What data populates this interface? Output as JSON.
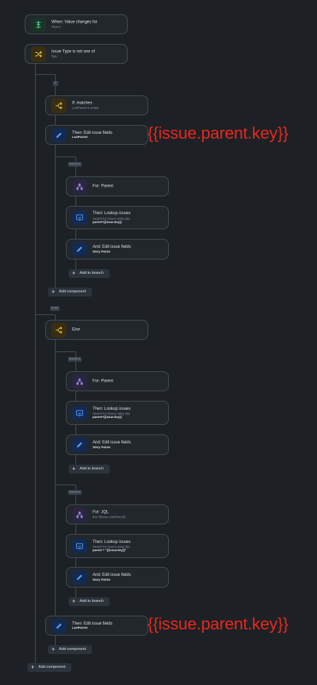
{
  "trigger": {
    "title": "When: Value changes for",
    "sub": "Parent"
  },
  "condition": {
    "title": "Issue Type is not one of",
    "sub": "Epic"
  },
  "if_tag": "IF",
  "if_block": {
    "title": "If: matches",
    "sub": "LastParent is empty"
  },
  "if_edit": {
    "title": "Then: Edit issue fields",
    "sub": "LastParent"
  },
  "branch_tag": "BRANCH",
  "branch1": {
    "for": {
      "title": "For: Parent"
    },
    "lookup": {
      "title": "Then: Lookup issues",
      "sub": "Search for issues using JQL",
      "sub2": "parent={{issue.key}}"
    },
    "edit": {
      "title": "And: Edit issue fields",
      "sub2": "Story Points"
    },
    "add": "Add to branch"
  },
  "add_component": "Add component",
  "else_tag": "ELSE",
  "else_block": {
    "title": "Else"
  },
  "branch2": {
    "for": {
      "title": "For: Parent"
    },
    "lookup": {
      "title": "Then: Lookup issues",
      "sub": "Search for issues using JQL",
      "sub2": "parent={{issue.key}}"
    },
    "edit": {
      "title": "And: Edit issue fields",
      "sub2": "Story Points"
    },
    "add": "Add to branch"
  },
  "branch3": {
    "for": {
      "title": "For: JQL",
      "sub": "key={{issue.LastParent}}"
    },
    "lookup": {
      "title": "Then: Lookup issues",
      "sub": "Search for issues using JQL",
      "sub2": "parent = \"{{issue.key}}\""
    },
    "edit": {
      "title": "And: Edit issue fields",
      "sub2": "Story Points"
    },
    "add": "Add to branch"
  },
  "else_edit": {
    "title": "Then: Edit issue fields",
    "sub": "LastParent"
  },
  "annotation": "{{issue.parent.key}}",
  "colors": {
    "background": "#1d2125",
    "card": "#22272b",
    "annotation": "#e8271d"
  }
}
